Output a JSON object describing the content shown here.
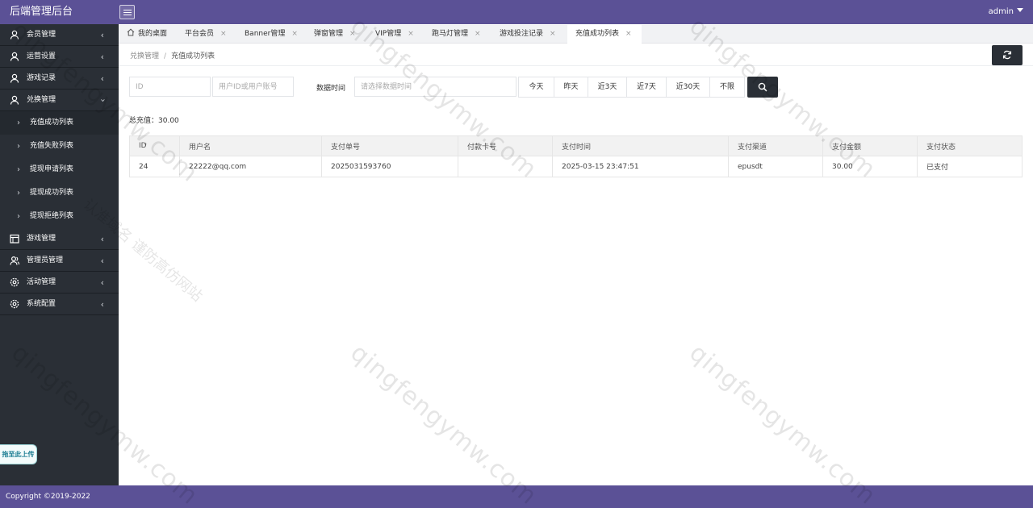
{
  "header": {
    "brand": "后端管理后台",
    "user": "admin"
  },
  "sidebar": {
    "items": [
      {
        "label": "会员管理",
        "icon": "user-icon"
      },
      {
        "label": "运营设置",
        "icon": "user-icon"
      },
      {
        "label": "游戏记录",
        "icon": "user-icon"
      },
      {
        "label": "兑换管理",
        "icon": "user-icon",
        "open": true,
        "children": [
          "充值成功列表",
          "充值失败列表",
          "提现申请列表",
          "提现成功列表",
          "提现拒绝列表"
        ]
      },
      {
        "label": "游戏管理",
        "icon": "calendar-icon"
      },
      {
        "label": "管理员管理",
        "icon": "users-icon"
      },
      {
        "label": "活动管理",
        "icon": "gear-icon"
      },
      {
        "label": "系统配置",
        "icon": "gear-icon"
      }
    ],
    "upload_label": "拖至此上传"
  },
  "tabs": [
    {
      "label": "我的桌面",
      "closable": false
    },
    {
      "label": "平台会员",
      "closable": true
    },
    {
      "label": "Banner管理",
      "closable": true
    },
    {
      "label": "弹窗管理",
      "closable": true
    },
    {
      "label": "VIP管理",
      "closable": true
    },
    {
      "label": "跑马灯管理",
      "closable": true
    },
    {
      "label": "游戏投注记录",
      "closable": true
    },
    {
      "label": "充值成功列表",
      "closable": true,
      "active": true
    }
  ],
  "breadcrumb": {
    "parent": "兑换管理",
    "separator": "/",
    "current": "充值成功列表"
  },
  "filters": {
    "id_placeholder": "ID",
    "user_placeholder": "用户ID或用户账号",
    "date_label": "数据时间",
    "date_placeholder": "请选择数据时间",
    "ranges": [
      "今天",
      "昨天",
      "近3天",
      "近7天",
      "近30天",
      "不限"
    ]
  },
  "summary": {
    "total_label": "总充值：",
    "total_value": "30.00"
  },
  "table": {
    "columns": [
      "ID",
      "用户名",
      "支付单号",
      "付款卡号",
      "支付时间",
      "支付渠道",
      "支付金额",
      "支付状态"
    ],
    "rows": [
      [
        "24",
        "22222@qq.com",
        "2025031593760",
        "",
        "2025-03-15 23:47:51",
        "epusdt",
        "30.00",
        "已支付"
      ]
    ]
  },
  "footer": {
    "copyright": "Copyright ©2019-2022"
  },
  "watermarks": {
    "site": "qingfengymw.com",
    "slogan": "认准域名 谨防高仿网站"
  },
  "colors": {
    "header": "#5b5196",
    "sidebar": "#2a2f36",
    "button_dark": "#2a2f36"
  }
}
